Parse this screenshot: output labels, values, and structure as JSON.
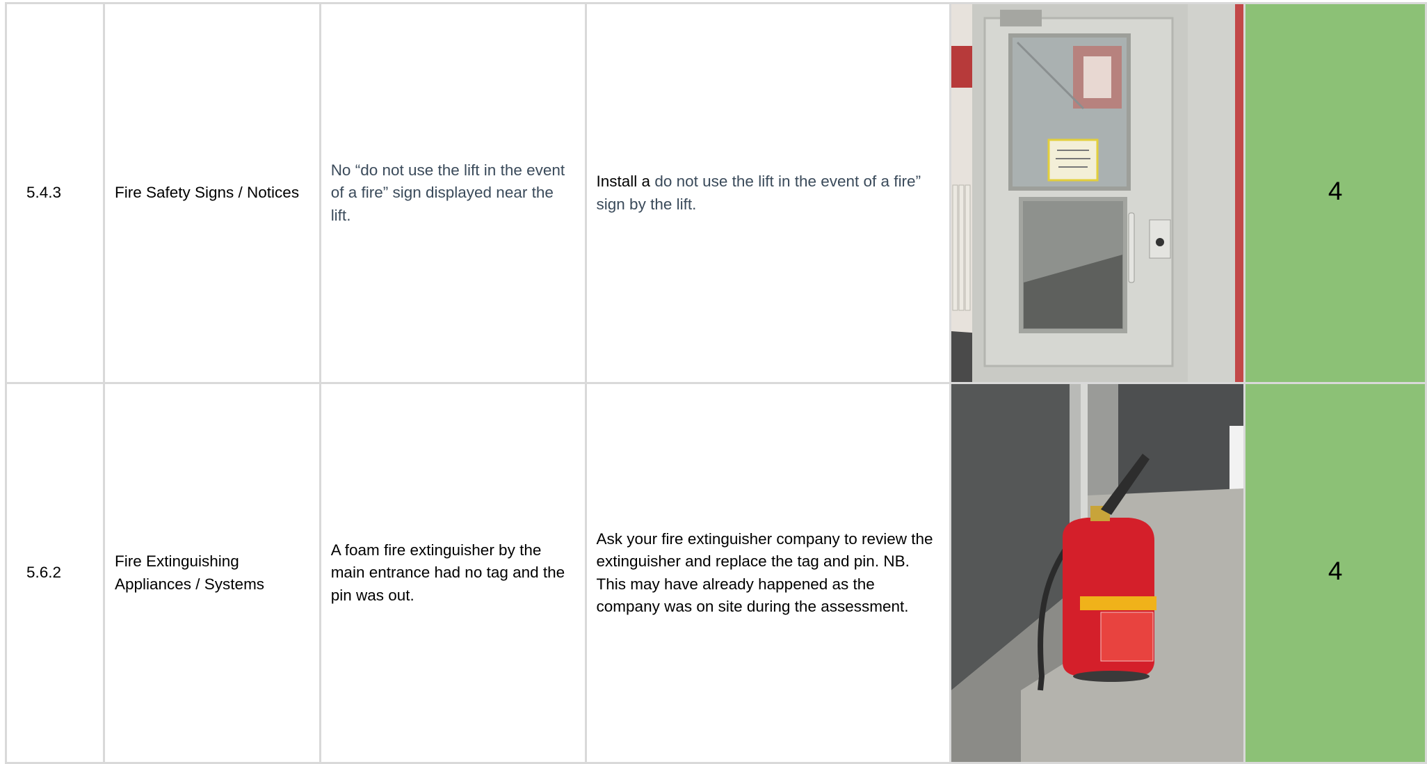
{
  "rows": [
    {
      "ref": "5.4.3",
      "area": "Fire Safety Signs / Notices",
      "observation": "No “do not use the lift in the event of a fire” sign displayed near the lift.",
      "action_prefix": "Install  a",
      "action_rest": " do not use the lift in the event of a fire” sign by the lift.",
      "photo_icon": "lift-door-photo",
      "score": "4"
    },
    {
      "ref": "5.6.2",
      "area": "Fire Extinguishing Appliances / Systems",
      "observation": "A foam fire extinguisher by the main entrance had no tag and the pin was out.",
      "action": "Ask your fire extinguisher company to review the extinguisher and replace the tag and pin. NB. This may have already happened as the company was on site during the assessment.",
      "photo_icon": "fire-extinguisher-photo",
      "score": "4"
    }
  ],
  "colors": {
    "score_bg": "#8cc176",
    "grid": "#d9d9d9"
  }
}
